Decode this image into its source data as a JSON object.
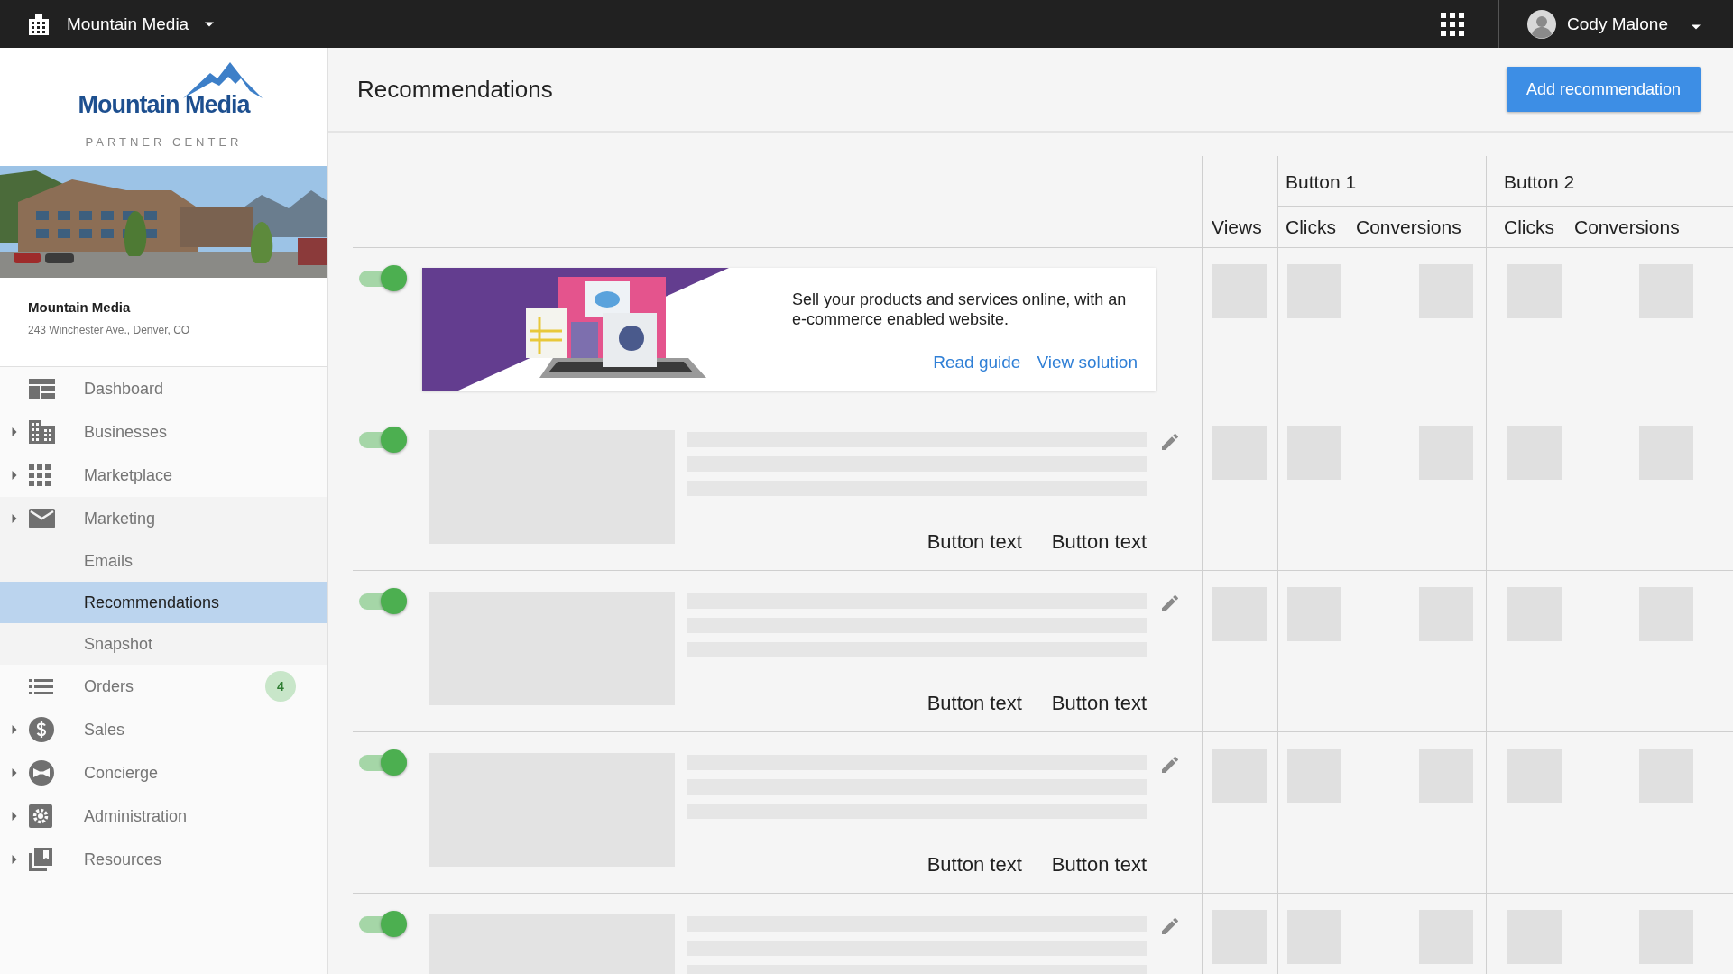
{
  "topbar": {
    "org": "Mountain Media",
    "user": "Cody Malone"
  },
  "brand": {
    "name": "Mountain Media",
    "tagline": "PARTNER CENTER"
  },
  "business": {
    "name": "Mountain Media",
    "address": "243 Winchester Ave., Denver, CO"
  },
  "nav": [
    {
      "label": "Dashboard",
      "caret": false,
      "selected": false
    },
    {
      "label": "Businesses",
      "caret": true,
      "selected": false
    },
    {
      "label": "Marketplace",
      "caret": true,
      "selected": false
    },
    {
      "label": "Marketing",
      "caret": true,
      "selected": false,
      "children": [
        {
          "label": "Emails",
          "selected": false
        },
        {
          "label": "Recommendations",
          "selected": true
        },
        {
          "label": "Snapshot",
          "selected": false
        }
      ]
    },
    {
      "label": "Orders",
      "caret": false,
      "selected": false,
      "badge": "4"
    },
    {
      "label": "Sales",
      "caret": true,
      "selected": false
    },
    {
      "label": "Concierge",
      "caret": true,
      "selected": false
    },
    {
      "label": "Administration",
      "caret": true,
      "selected": false
    },
    {
      "label": "Resources",
      "caret": true,
      "selected": false
    }
  ],
  "page": {
    "title": "Recommendations",
    "add_button": "Add recommendation"
  },
  "table": {
    "groups": [
      "Button 1",
      "Button 2"
    ],
    "columns": [
      "Views",
      "Clicks",
      "Conversions",
      "Clicks",
      "Conversions"
    ],
    "rows": [
      {
        "kind": "promo",
        "on": true,
        "text": "Sell your products and services online, with an e-commerce enabled website.",
        "links": [
          "Read guide",
          "View solution"
        ]
      },
      {
        "kind": "placeholder",
        "on": true,
        "buttons": [
          "Button text",
          "Button text"
        ]
      },
      {
        "kind": "placeholder",
        "on": true,
        "buttons": [
          "Button text",
          "Button text"
        ]
      },
      {
        "kind": "placeholder",
        "on": true,
        "buttons": [
          "Button text",
          "Button text"
        ]
      },
      {
        "kind": "placeholder",
        "on": true
      }
    ]
  }
}
